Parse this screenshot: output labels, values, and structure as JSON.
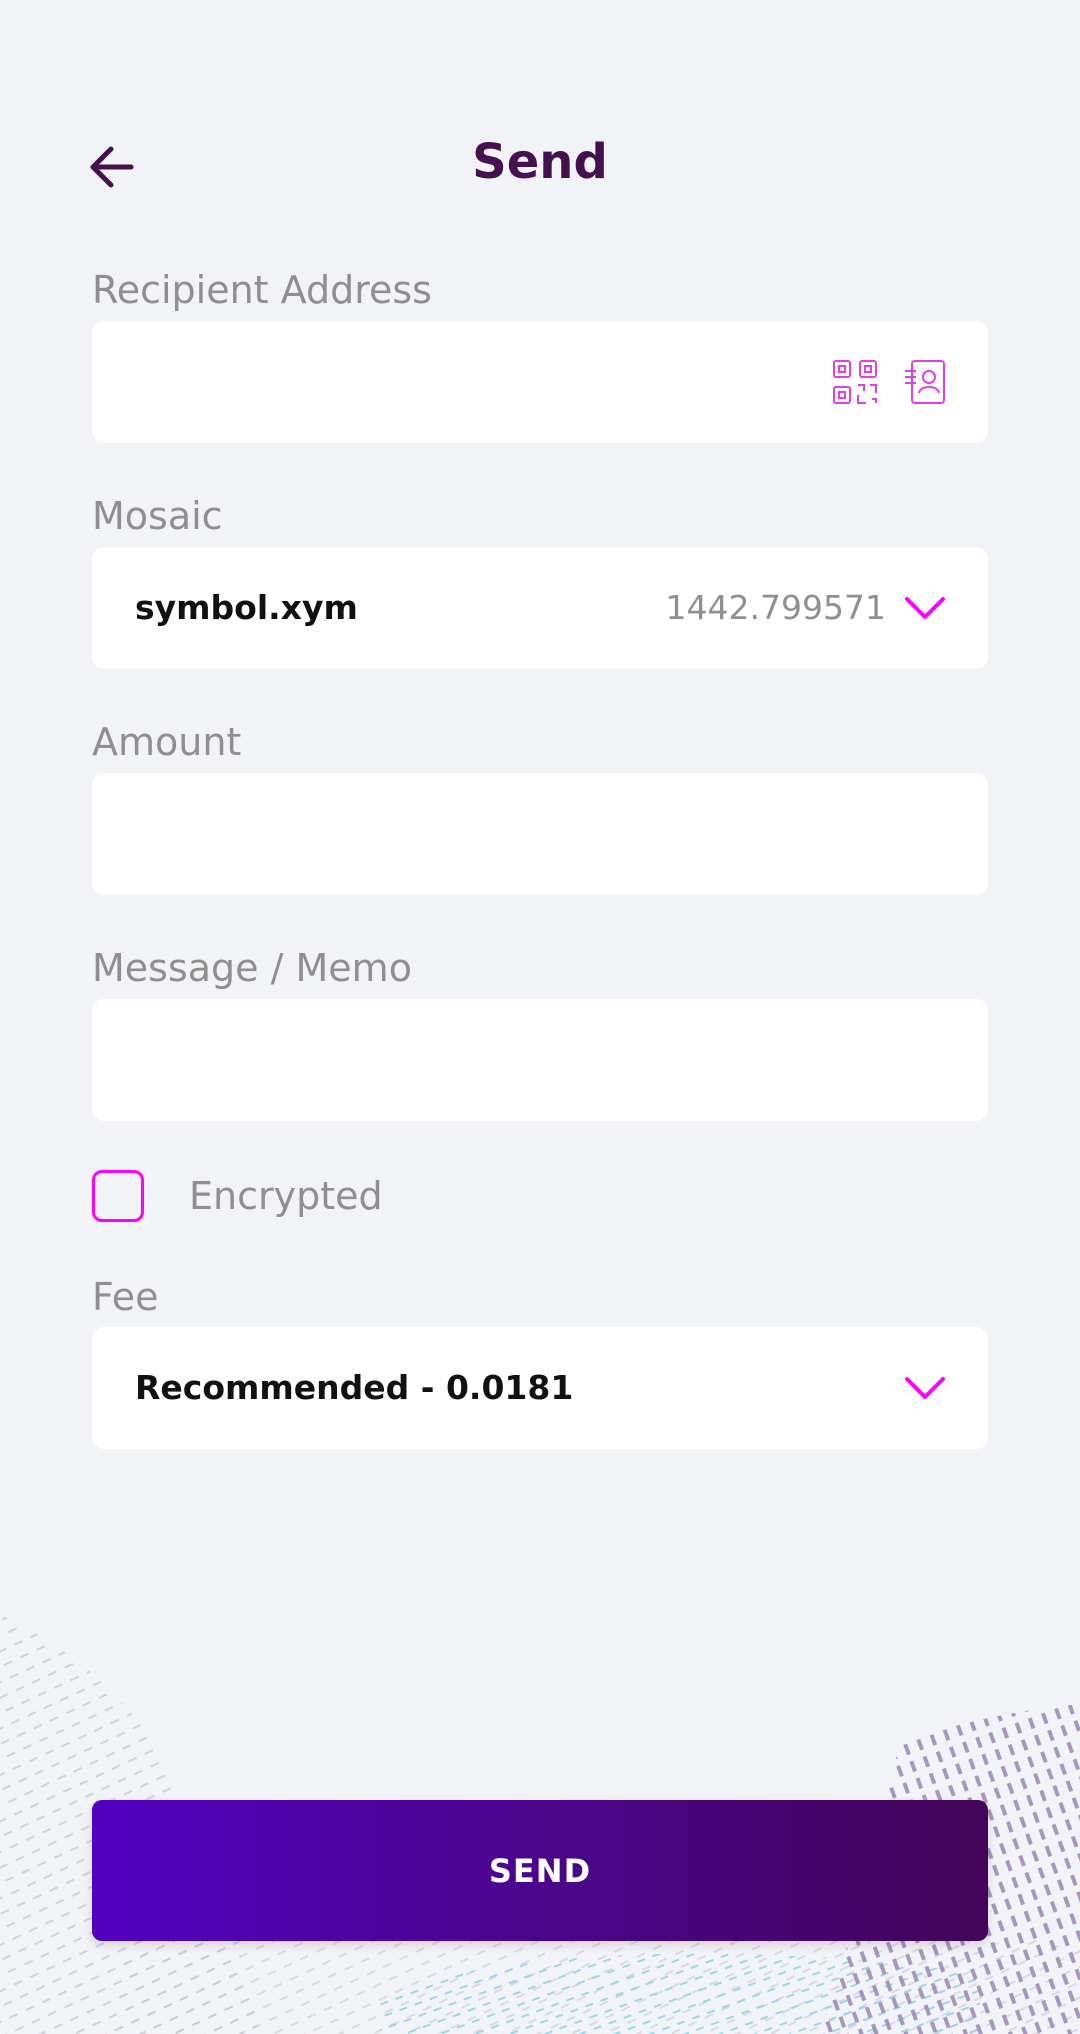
{
  "header": {
    "title": "Send",
    "back_icon": "arrow-left-icon"
  },
  "recipient": {
    "label": "Recipient Address",
    "value": "",
    "placeholder": "",
    "qr_icon": "qr-code-icon",
    "contacts_icon": "address-book-icon"
  },
  "mosaic": {
    "label": "Mosaic",
    "selected": "symbol.xym",
    "balance": "1442.799571",
    "chevron_icon": "chevron-down-icon"
  },
  "amount": {
    "label": "Amount",
    "value": "",
    "placeholder": ""
  },
  "message": {
    "label": "Message / Memo",
    "value": "",
    "placeholder": ""
  },
  "encrypted": {
    "label": "Encrypted",
    "checked": false
  },
  "fee": {
    "label": "Fee",
    "selected": "Recommended - 0.0181",
    "chevron_icon": "chevron-down-icon"
  },
  "send_button": {
    "label": "SEND"
  },
  "colors": {
    "accent": "#ff00ff",
    "title": "#44104e",
    "label": "#8f8f8f",
    "background": "#f2f3f7",
    "button_start": "#5200c0",
    "button_end": "#420558"
  }
}
